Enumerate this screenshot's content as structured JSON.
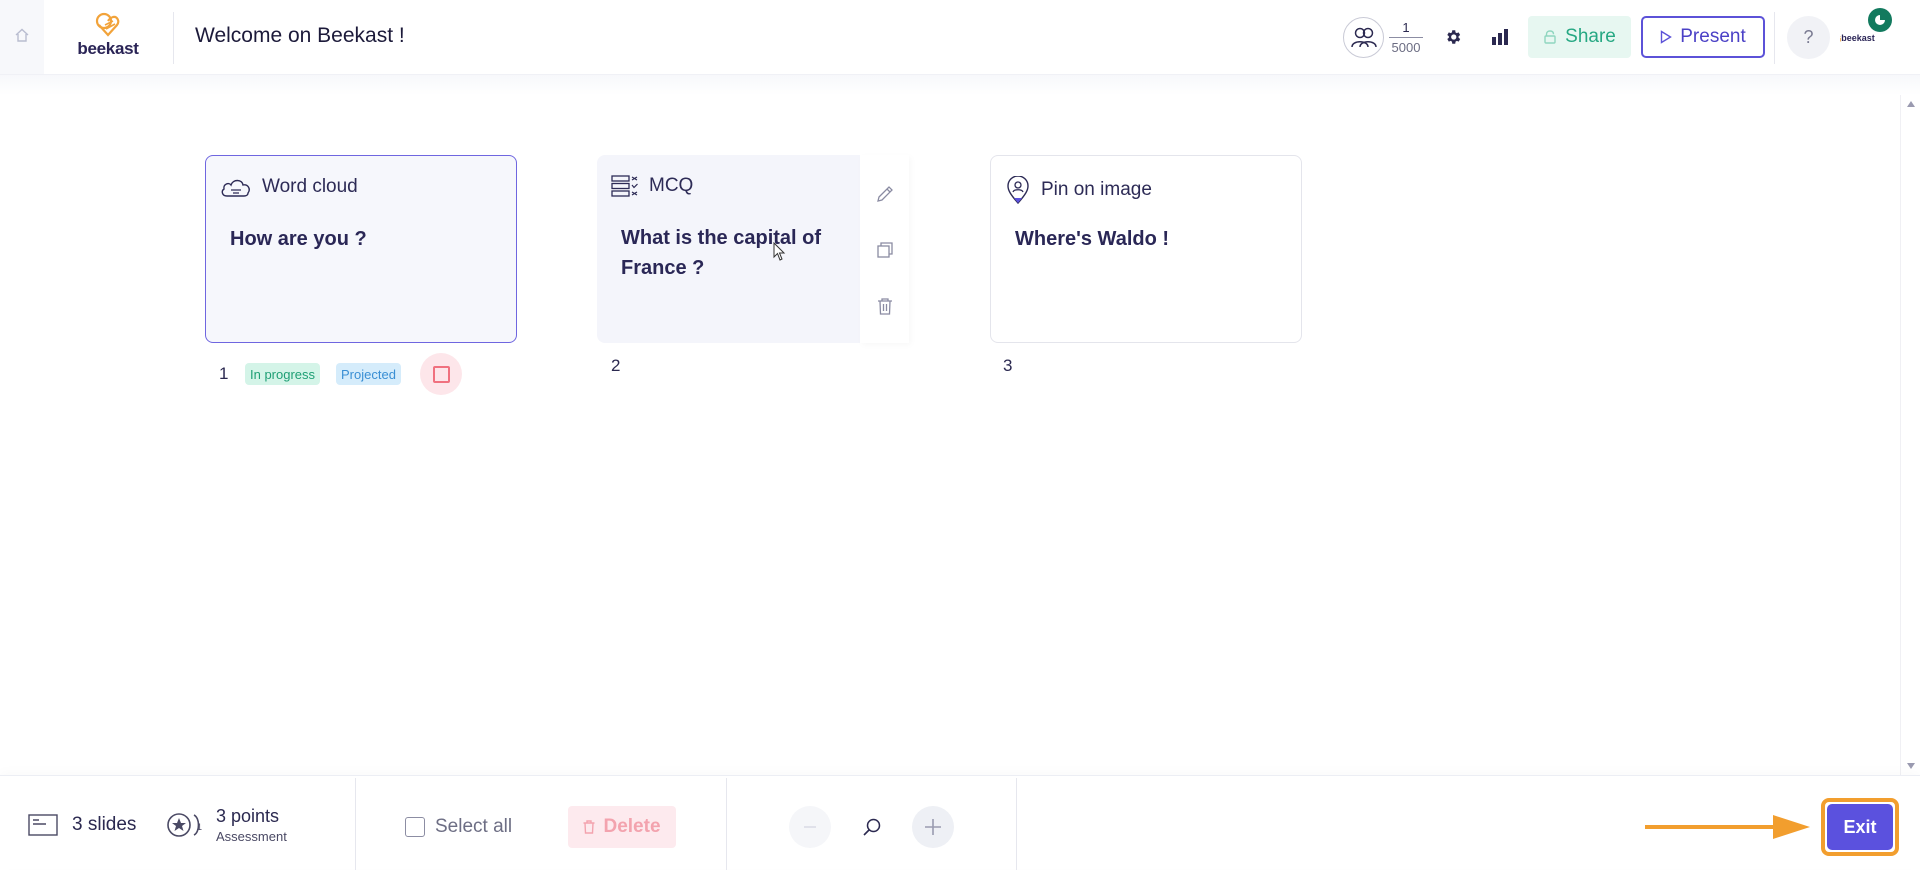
{
  "header": {
    "title": "Welcome on Beekast !",
    "logo_text": "beekast",
    "participants": {
      "current": "1",
      "max": "5000"
    },
    "share_label": "Share",
    "present_label": "Present",
    "help_label": "?",
    "brand_mini": "beekast"
  },
  "slides": [
    {
      "type": "Word cloud",
      "question": "How are you ?",
      "number": "1",
      "status": "In progress",
      "projection": "Projected"
    },
    {
      "type": "MCQ",
      "question": "What is the capital of France ?",
      "number": "2"
    },
    {
      "type": "Pin on image",
      "question": "Where's Waldo !",
      "number": "3"
    }
  ],
  "footer": {
    "slides_count": "3 slides",
    "points": "3 points",
    "points_sub": "Assessment",
    "select_all": "Select all",
    "delete": "Delete",
    "exit": "Exit"
  },
  "colors": {
    "accent": "#5b51de",
    "share_green": "#26a883",
    "highlight": "#f29e2e",
    "brand_orange": "#f2a33a"
  },
  "icons": {
    "home": "home-icon",
    "participants": "participants-icon",
    "settings": "gear-icon",
    "stats": "bar-chart-icon",
    "share": "lock-icon",
    "present": "play-icon",
    "word_cloud": "cloud-icon",
    "mcq": "list-check-icon",
    "pin": "map-pin-icon",
    "edit": "pencil-icon",
    "duplicate": "copy-icon",
    "delete": "trash-icon"
  }
}
